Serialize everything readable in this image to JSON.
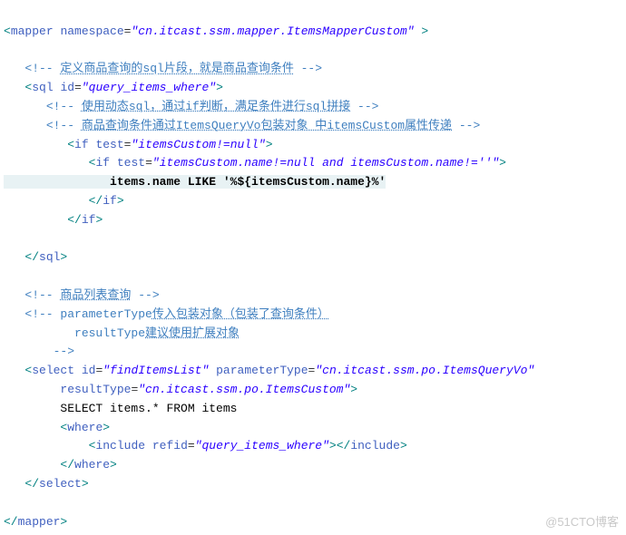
{
  "code": {
    "mapper_open1": "<mapper",
    "attr_namespace": "namespace",
    "val_namespace": "\"cn.itcast.ssm.mapper.ItemsMapperCustom\"",
    "gt": " >",
    "blank": "",
    "cmt_sql": "<!-- 定义商品查询的sql片段，就是商品查询条件 -->",
    "sql_open": "<sql",
    "attr_id": "id",
    "val_sql_id": "\"query_items_where\"",
    "cmt_if1": "<!-- 使用动态sql，通过if判断，满足条件进行sql拼接 -->",
    "cmt_if2": "<!-- 商品查询条件通过ItemsQueryVo包装对象 中itemsCustom属性传递 -->",
    "if_open": "<if",
    "attr_test": "test",
    "val_test_outer": "\"itemsCustom!=null\"",
    "val_test_inner": "\"itemsCustom.name!=null and itemsCustom.name!=''\"",
    "like_line": "items.name LIKE '%${itemsCustom.name}%'",
    "if_close": "</if>",
    "sql_close": "</sql>",
    "cmt_list": "<!-- 商品列表查询 -->",
    "cmt_pt1": "<!-- parameterType传入包装对象（包装了查询条件）",
    "cmt_pt2": "resultType建议使用扩展对象",
    "cmt_pt3": " -->",
    "select_open": "<select",
    "val_select_id": "\"findItemsList\"",
    "attr_parameterType": "parameterType",
    "val_parameterType": "\"cn.itcast.ssm.po.ItemsQueryVo\"",
    "attr_resultType": "resultType",
    "val_resultType": "\"cn.itcast.ssm.po.ItemsCustom\"",
    "select_sql": "SELECT items.* FROM items",
    "where_open": "<where>",
    "include_open": "<include",
    "attr_refid": "refid",
    "val_refid": "\"query_items_where\"",
    "include_close": "></include>",
    "where_close": "</where>",
    "select_close": "</select>",
    "mapper_close": "</mapper>"
  },
  "watermark": "@51CTO博客",
  "indent": {
    "i0": "",
    "i1": "   ",
    "i2": "      ",
    "i3": "         ",
    "i4": "            ",
    "i5": "               ",
    "iselect2": "        ",
    "icmt2": "          "
  }
}
